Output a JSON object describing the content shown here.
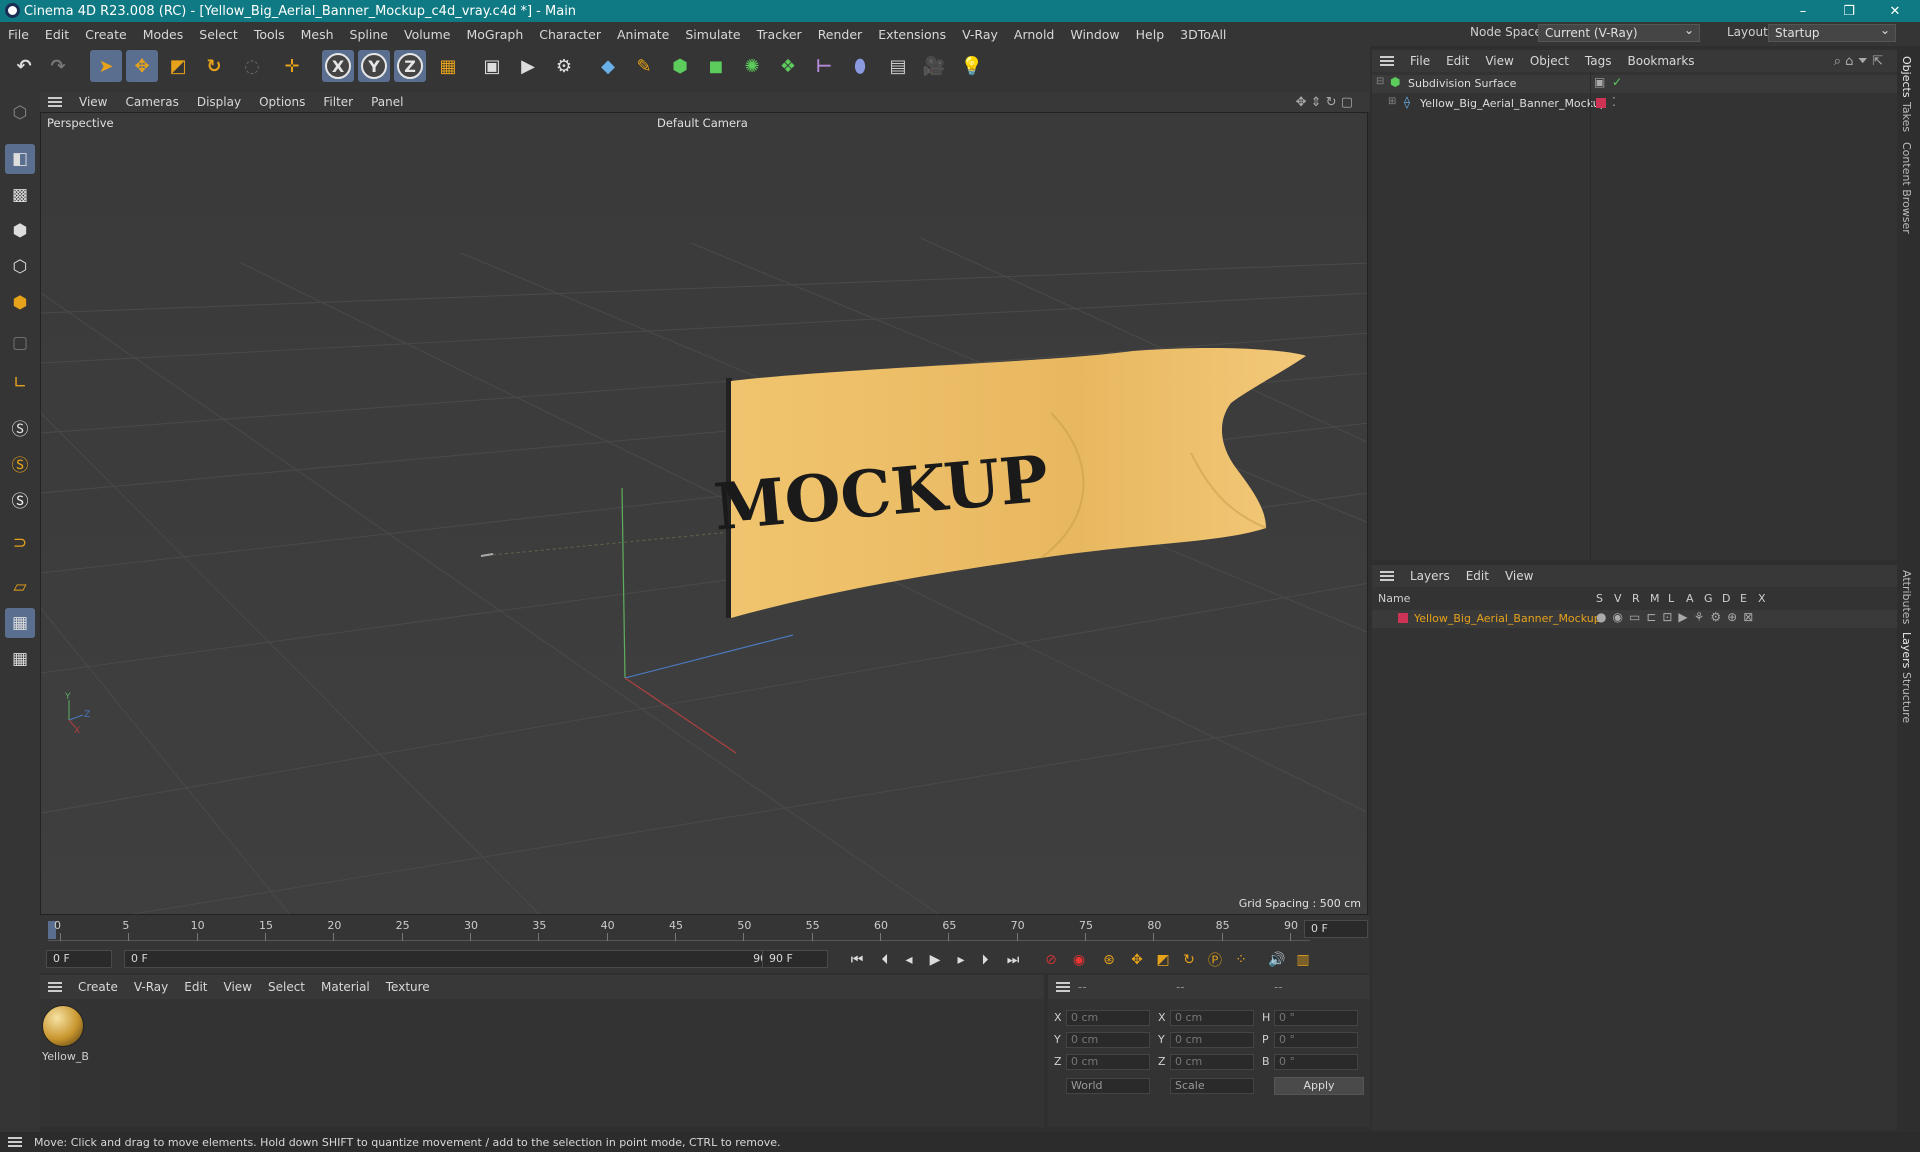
{
  "window": {
    "title": "Cinema 4D R23.008 (RC) - [Yellow_Big_Aerial_Banner_Mockup_c4d_vray.c4d *] - Main",
    "minimize": "–",
    "restore": "❐",
    "close": "✕"
  },
  "menubar": {
    "items": [
      "File",
      "Edit",
      "Create",
      "Modes",
      "Select",
      "Tools",
      "Mesh",
      "Spline",
      "Volume",
      "MoGraph",
      "Character",
      "Animate",
      "Simulate",
      "Tracker",
      "Render",
      "Extensions",
      "V-Ray",
      "Arnold",
      "Window",
      "Help",
      "3DToAll"
    ],
    "node_space_label": "Node Space:",
    "node_space_value": "Current (V-Ray)",
    "layout_label": "Layout:",
    "layout_value": "Startup"
  },
  "viewport": {
    "menu": [
      "View",
      "Cameras",
      "Display",
      "Options",
      "Filter",
      "Panel"
    ],
    "label": "Perspective",
    "camera": "Default Camera ",
    "grid_spacing": "Grid Spacing : 500 cm",
    "banner_text": "MOCKUP",
    "axis_y": "Y",
    "axis_z": "Z",
    "axis_x": "X"
  },
  "timeline": {
    "ticks": [
      "0",
      "5",
      "10",
      "15",
      "20",
      "25",
      "30",
      "35",
      "40",
      "45",
      "50",
      "55",
      "60",
      "65",
      "70",
      "75",
      "80",
      "85",
      "90"
    ],
    "current_frame": "0 F"
  },
  "transport": {
    "start": "0 F",
    "range_start": "0 F",
    "range_end": "90 F",
    "end": "90 F"
  },
  "materials": {
    "menu": [
      "Create",
      "V-Ray",
      "Edit",
      "View",
      "Select",
      "Material",
      "Texture"
    ],
    "items": [
      {
        "name": "Yellow_B"
      }
    ]
  },
  "coords": {
    "headers": [
      "--",
      "--",
      "--"
    ],
    "rows": [
      {
        "l1": "X",
        "v1": "0 cm",
        "l2": "X",
        "v2": "0 cm",
        "l3": "H",
        "v3": "0 °"
      },
      {
        "l1": "Y",
        "v1": "0 cm",
        "l2": "Y",
        "v2": "0 cm",
        "l3": "P",
        "v3": "0 °"
      },
      {
        "l1": "Z",
        "v1": "0 cm",
        "l2": "Z",
        "v2": "0 cm",
        "l3": "B",
        "v3": "0 °"
      }
    ],
    "space": "World",
    "mode": "Scale",
    "apply": "Apply"
  },
  "objects": {
    "menu": [
      "File",
      "Edit",
      "View",
      "Object",
      "Tags",
      "Bookmarks"
    ],
    "items": [
      {
        "name": "Subdivision Surface"
      },
      {
        "name": "Yellow_Big_Aerial_Banner_Mockup"
      }
    ]
  },
  "layers": {
    "menu": [
      "Layers",
      "Edit",
      "View"
    ],
    "columns": [
      "Name",
      "S",
      "V",
      "R",
      "M",
      "L",
      "A",
      "G",
      "D",
      "E",
      "X"
    ],
    "items": [
      {
        "name": "Yellow_Big_Aerial_Banner_Mockup",
        "color": "#cc3355"
      }
    ]
  },
  "side_tabs": [
    "Objects",
    "Takes",
    "Content Browser",
    "Attributes",
    "Layers",
    "Structure"
  ],
  "status": "Move: Click and drag to move elements. Hold down SHIFT to quantize movement / add to the selection in point mode, CTRL to remove.",
  "colors": {
    "accent": "#e6a21a",
    "titlebar": "#0f7a83",
    "banner": "#eebf6a",
    "layer_color": "#cc3355"
  }
}
